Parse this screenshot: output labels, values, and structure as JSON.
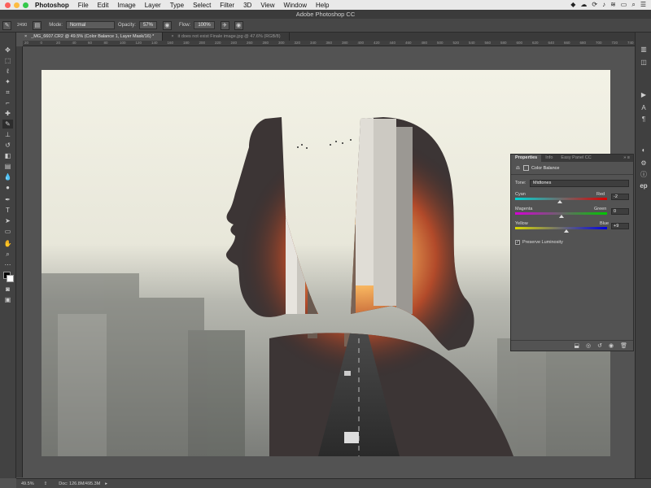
{
  "menubar": {
    "app": "Photoshop",
    "items": [
      "File",
      "Edit",
      "Image",
      "Layer",
      "Type",
      "Select",
      "Filter",
      "3D",
      "View",
      "Window",
      "Help"
    ]
  },
  "titlebar": {
    "title": "Adobe Photoshop CC"
  },
  "optionsbar": {
    "size": "2490",
    "mode_label": "Mode:",
    "mode_value": "Normal",
    "opacity_label": "Opacity:",
    "opacity_value": "57%",
    "flow_label": "Flow:",
    "flow_value": "100%"
  },
  "tabs": [
    {
      "label": "_MG_6607.CR2 @ 49.5% (Color Balance 1, Layer Mask/16) *"
    },
    {
      "label": "it does not exist Finale image.jpg @ 47.6% (RGB/8)"
    }
  ],
  "ruler": {
    "labels": [
      "20",
      "0",
      "20",
      "40",
      "60",
      "80",
      "100",
      "120",
      "140",
      "160",
      "180",
      "200",
      "220",
      "240",
      "260",
      "280",
      "300",
      "320",
      "340",
      "360",
      "380",
      "400",
      "420",
      "440",
      "460",
      "480",
      "500",
      "520",
      "540",
      "560",
      "580",
      "600",
      "620",
      "640",
      "660",
      "680",
      "700",
      "720",
      "740"
    ]
  },
  "properties": {
    "tabs": [
      "Properties",
      "Info",
      "Easy Panel CC"
    ],
    "header": "Color Balance",
    "tone_label": "Tone:",
    "tone_value": "Midtones",
    "sliders": [
      {
        "left": "Cyan",
        "right": "Red",
        "value": "-2",
        "fraction": 0.49
      },
      {
        "left": "Magenta",
        "right": "Green",
        "value": "0",
        "fraction": 0.5
      },
      {
        "left": "Yellow",
        "right": "Blue",
        "value": "+9",
        "fraction": 0.56
      }
    ],
    "preserve_label": "Preserve Luminosity",
    "preserve_checked": true
  },
  "status": {
    "zoom": "49.5%",
    "doc": "Doc: 126.8M/495.3M"
  },
  "rightpanel": {
    "ep_label": "ep"
  },
  "colors": {
    "accent": "#2a5fa8",
    "panel": "#535353",
    "toolbar": "#424242"
  }
}
